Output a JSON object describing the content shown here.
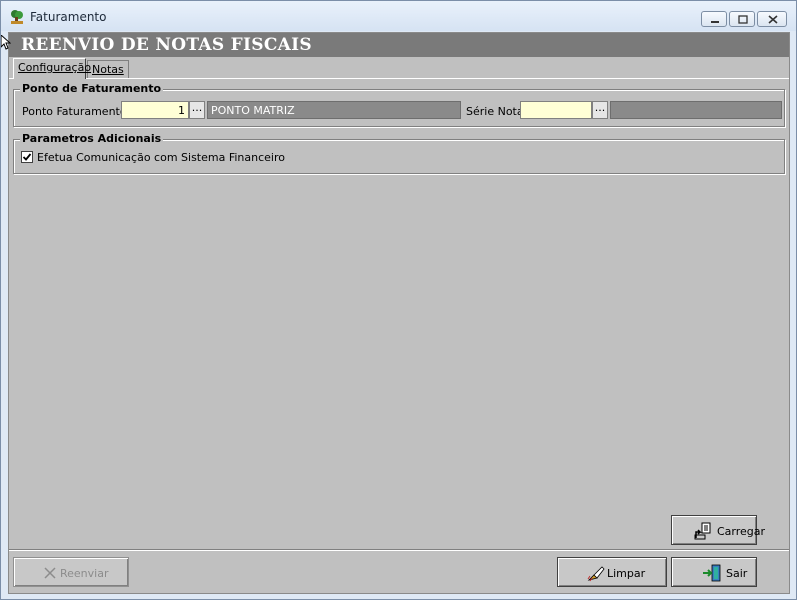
{
  "window": {
    "title": "Faturamento",
    "icon": "app-tree-icon"
  },
  "header": {
    "title": "REENVIO DE NOTAS FISCAIS"
  },
  "tabs": [
    {
      "label": "Configuração",
      "active": true
    },
    {
      "label": "Notas",
      "active": false
    }
  ],
  "ponto_faturamento": {
    "legend": "Ponto de Faturamento",
    "ponto_label": "Ponto Faturamento",
    "ponto_value": "1",
    "ponto_desc": "PONTO MATRIZ",
    "serie_label": "Série Nota",
    "serie_value": "",
    "serie_desc": "",
    "lookup_label": "..."
  },
  "parametros": {
    "legend": "Parametros Adicionais",
    "efetua_label": "Efetua Comunicação com Sistema Financeiro",
    "efetua_checked": true
  },
  "buttons": {
    "carregar": "Carregar",
    "reenviar": "Reenviar",
    "limpar": "Limpar",
    "sair": "Sair"
  },
  "colors": {
    "header_band": "#7a7a7a",
    "field_bg": "#ffffd6",
    "form_bg": "#c0c0c0"
  }
}
